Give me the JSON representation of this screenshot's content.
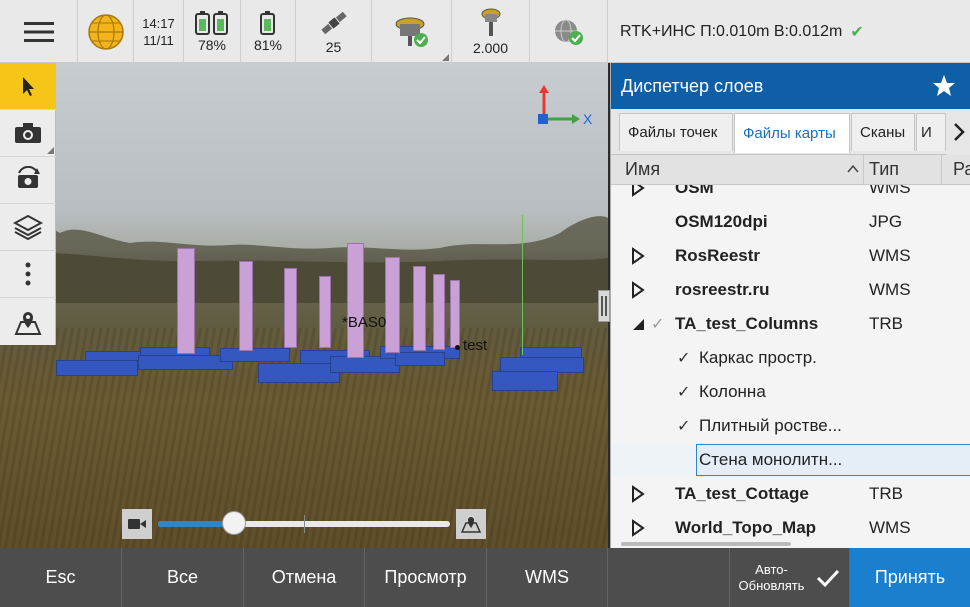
{
  "status_bar": {
    "time": "14:17",
    "date": "11/11",
    "battery1": "78%",
    "battery2": "81%",
    "satellites": "25",
    "antenna_height": "2.000",
    "precision": "RTK+ИНС П:0.010m В:0.012m"
  },
  "view": {
    "axis_x_label": "X",
    "points": [
      {
        "label": "BAS0"
      },
      {
        "label": "test"
      }
    ],
    "slider_value": 0.26
  },
  "layer_manager": {
    "title": "Диспетчер слоев",
    "tabs": [
      "Файлы точек",
      "Файлы карты",
      "Сканы",
      "И"
    ],
    "active_tab": 1,
    "columns": {
      "name": "Имя",
      "type": "Тип",
      "extra": "Ра"
    },
    "rows": [
      {
        "name": "OSM",
        "type": "WMS",
        "kind": "layer",
        "expander": "collapsed"
      },
      {
        "name": "OSM120dpi",
        "type": "JPG",
        "kind": "layer",
        "expander": "none"
      },
      {
        "name": "RosReestr",
        "type": "WMS",
        "kind": "layer",
        "expander": "collapsed"
      },
      {
        "name": "rosreestr.ru",
        "type": "WMS",
        "kind": "layer",
        "expander": "collapsed"
      },
      {
        "name": "TA_test_Columns",
        "type": "TRB",
        "kind": "layer",
        "expander": "expanded",
        "checked": true
      },
      {
        "name": "Каркас простр.",
        "type": "",
        "kind": "sub",
        "checked": true
      },
      {
        "name": "Колонна",
        "type": "",
        "kind": "sub",
        "checked": true
      },
      {
        "name": "Плитный ростве...",
        "type": "",
        "kind": "sub",
        "checked": true
      },
      {
        "name": "Стена монолитн...",
        "type": "",
        "kind": "sub",
        "checked": false,
        "selected": true
      },
      {
        "name": "TA_test_Cottage",
        "type": "TRB",
        "kind": "layer",
        "expander": "collapsed"
      },
      {
        "name": "World_Topo_Map",
        "type": "WMS",
        "kind": "layer",
        "expander": "collapsed"
      }
    ]
  },
  "bottom_bar": {
    "esc": "Esc",
    "all": "Все",
    "cancel": "Отмена",
    "view": "Просмотр",
    "wms": "WMS",
    "auto_update_line1": "Авто-",
    "auto_update_line2": "Обновлять",
    "accept": "Принять"
  },
  "colors": {
    "accent": "#0f5fa6",
    "accept": "#1b7fcf",
    "active_tool": "#f5c518",
    "column": "#c9a1d6",
    "slab": "#3457c0",
    "ok": "#4caf50"
  }
}
